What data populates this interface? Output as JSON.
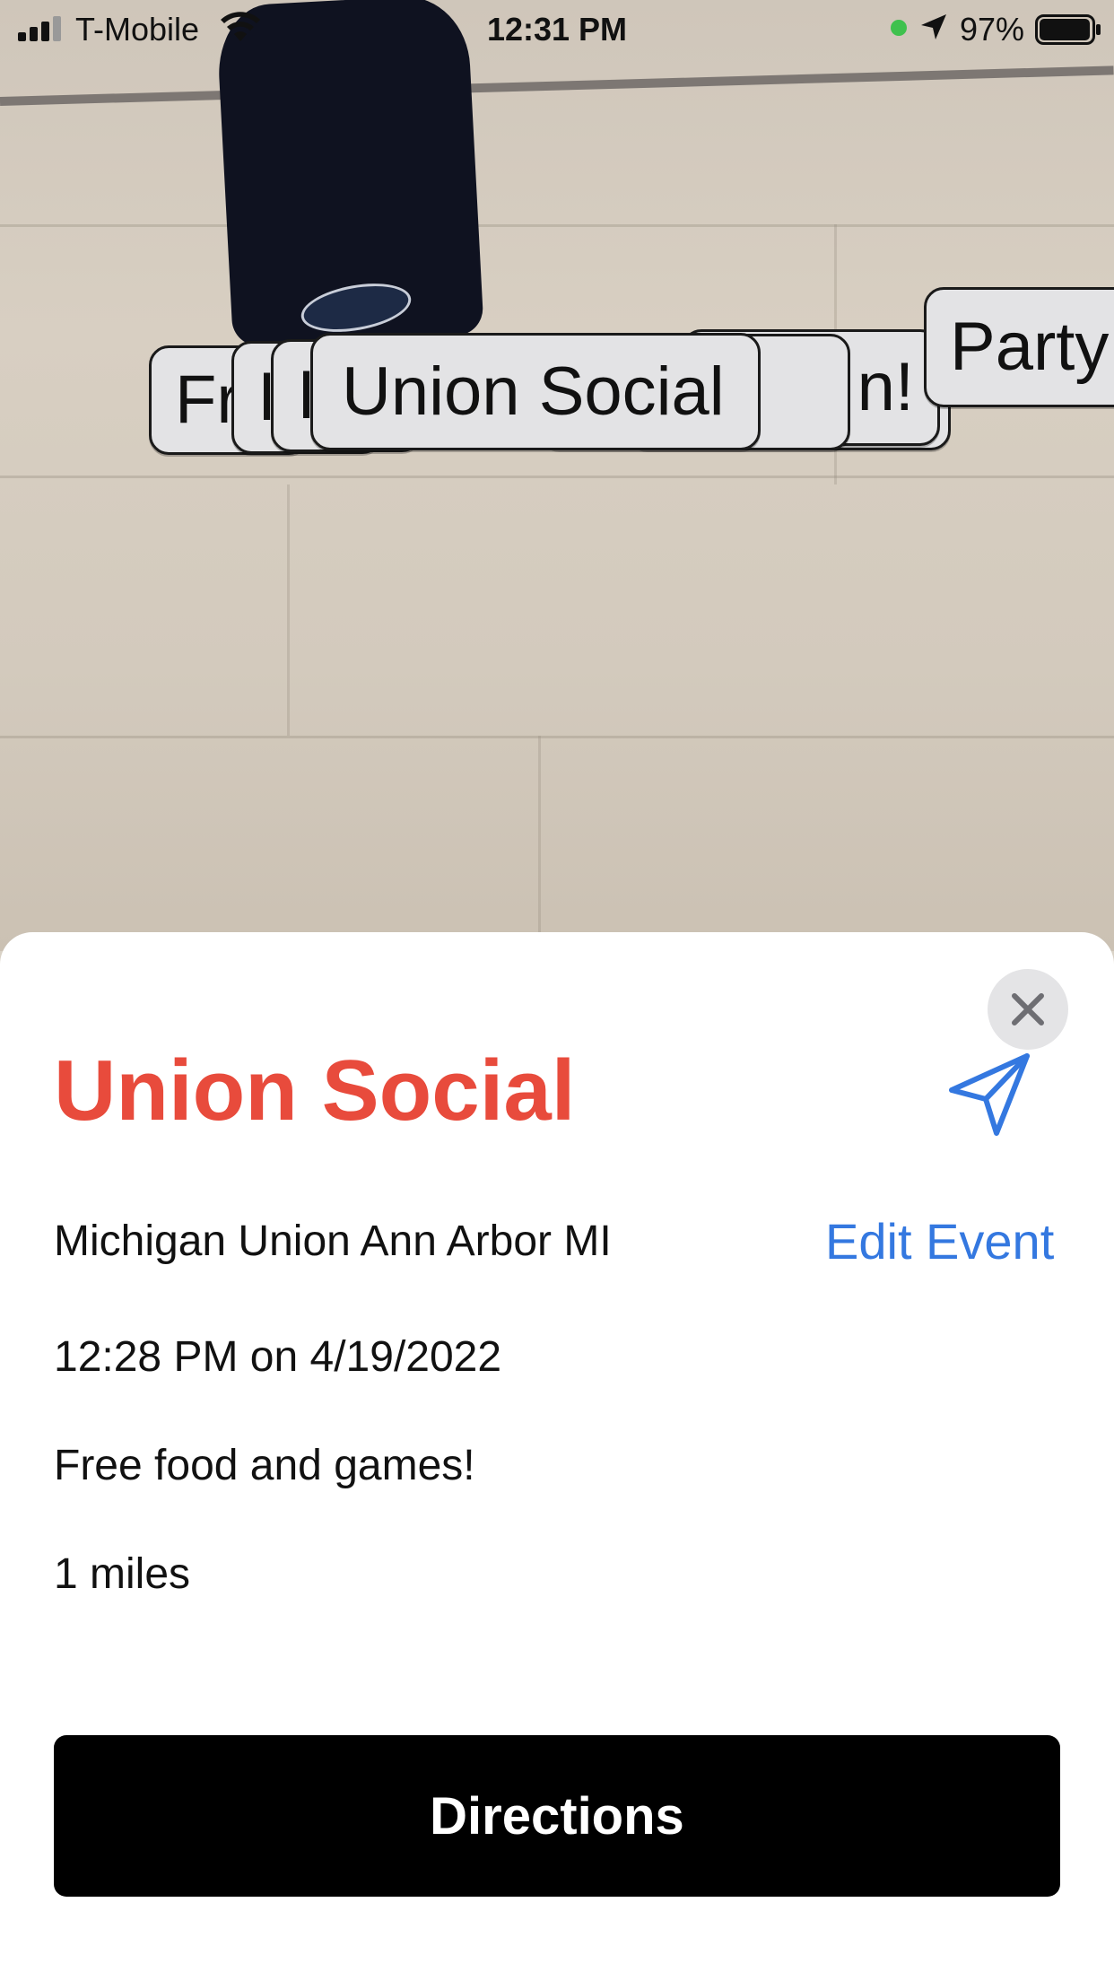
{
  "status_bar": {
    "carrier": "T-Mobile",
    "time": "12:31 PM",
    "battery": "97%"
  },
  "ar_tags": [
    {
      "label": "Fr"
    },
    {
      "label": "I"
    },
    {
      "label": "I"
    },
    {
      "label": "n!"
    },
    {
      "label": "Party"
    },
    {
      "label": "Union Social"
    }
  ],
  "event": {
    "title": "Union Social",
    "location": "Michigan Union Ann Arbor MI",
    "edit_label": "Edit Event",
    "datetime": "12:28 PM on 4/19/2022",
    "description": "Free food and games!",
    "distance": "1 miles",
    "directions_label": "Directions"
  },
  "colors": {
    "title": "#e84b3c",
    "link": "#3478e0",
    "button_bg": "#000000"
  },
  "icons": [
    "signal-icon",
    "wifi-icon",
    "location-arrow-icon",
    "battery-icon",
    "close-icon",
    "send-icon"
  ]
}
